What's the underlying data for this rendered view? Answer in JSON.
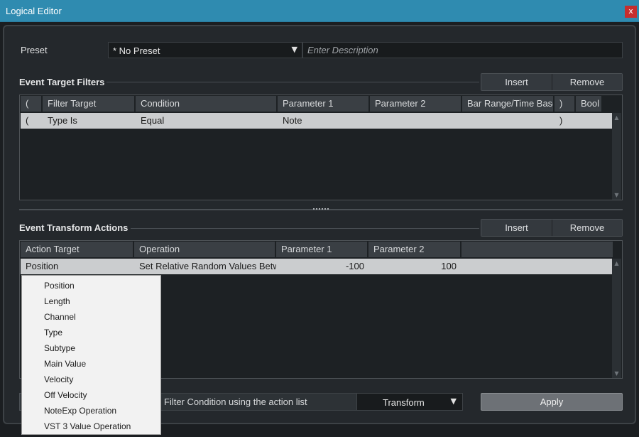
{
  "window": {
    "title": "Logical Editor",
    "close_label": "x"
  },
  "preset": {
    "label": "Preset",
    "value": "* No Preset",
    "description_placeholder": "Enter Description"
  },
  "filters": {
    "title": "Event Target Filters",
    "insert_label": "Insert",
    "remove_label": "Remove",
    "columns": [
      "(",
      "Filter Target",
      "Condition",
      "Parameter 1",
      "Parameter 2",
      "Bar Range/Time Base",
      ")",
      "Bool"
    ],
    "rows": [
      {
        "open": "(",
        "filter_target": "Type Is",
        "condition": "Equal",
        "parameter1": "Note",
        "parameter2": "",
        "bar_range": "",
        "close": ")",
        "bool": ""
      }
    ]
  },
  "actions": {
    "title": "Event Transform Actions",
    "insert_label": "Insert",
    "remove_label": "Remove",
    "columns": [
      "Action Target",
      "Operation",
      "Parameter 1",
      "Parameter 2"
    ],
    "rows": [
      {
        "action_target": "Position",
        "operation": "Set Relative Random Values Between",
        "parameter1": "-100",
        "parameter2": "100"
      }
    ]
  },
  "dropdown": {
    "items": [
      "Position",
      "Length",
      "Channel",
      "Type",
      "Subtype",
      "Main Value",
      "Velocity",
      "Off Velocity",
      "NoteExp Operation",
      "VST 3 Value Operation"
    ]
  },
  "footer": {
    "mode_text": "Filter Condition using the action list",
    "function_value": "Transform",
    "apply_label": "Apply"
  }
}
